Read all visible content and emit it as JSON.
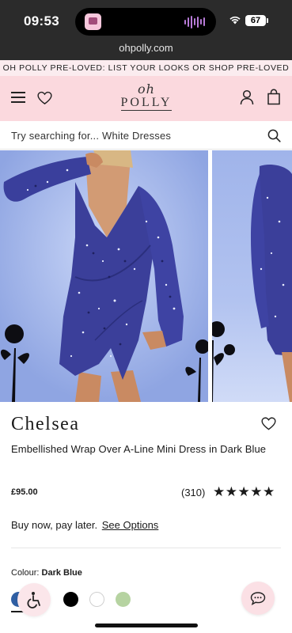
{
  "status_bar": {
    "time": "09:53",
    "battery": "67"
  },
  "browser": {
    "url": "ohpolly.com"
  },
  "promo_banner": {
    "text": "OH POLLY PRE-LOVED: LIST YOUR LOOKS OR SHOP PRE-LOVED"
  },
  "header": {
    "logo_top": "oh",
    "logo_bottom": "POLLY"
  },
  "search": {
    "placeholder": "Try searching for...  White Dresses"
  },
  "product": {
    "name": "Chelsea",
    "description": "Embellished Wrap Over A-Line Mini Dress in Dark Blue",
    "price": "£95.00",
    "review_count": "(310)",
    "rating_stars": "★★★★★",
    "rating": 5,
    "bnpl_text": "Buy now, pay later.",
    "bnpl_link": "See Options",
    "colour_label": "Colour:",
    "colour_value": "Dark Blue",
    "swatches": [
      "#2f5fa3",
      "#000000",
      "#ffffff",
      "#b6d3a1"
    ]
  },
  "colors": {
    "header_pink": "#fbd9de",
    "promo_pink": "#fbecef",
    "dress_blue": "#3b3f9a"
  }
}
